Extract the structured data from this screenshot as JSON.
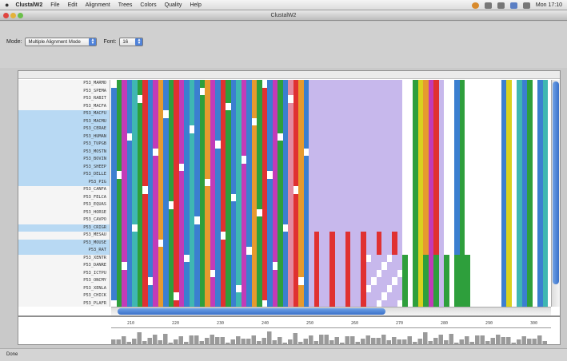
{
  "menubar": {
    "app_name": "ClustalW2",
    "menus": [
      "File",
      "Edit",
      "Alignment",
      "Trees",
      "Colors",
      "Quality",
      "Help"
    ],
    "status_text": "Mon 17:10"
  },
  "window": {
    "title": "ClustalW2"
  },
  "toolbar": {
    "mode_label": "Mode:",
    "mode_value": "Multiple Alignment Mode",
    "font_label": "Font:",
    "font_value": "16"
  },
  "alignment": {
    "sequences": [
      {
        "name": "P53_MARMO",
        "selected": false
      },
      {
        "name": "P53_SPEMA",
        "selected": false
      },
      {
        "name": "P53_RABIT",
        "selected": false
      },
      {
        "name": "P53_MACFA",
        "selected": false
      },
      {
        "name": "P53_MACFU",
        "selected": true
      },
      {
        "name": "P53_MACMU",
        "selected": true
      },
      {
        "name": "P53_CERAE",
        "selected": true
      },
      {
        "name": "P53_HUMAN",
        "selected": true
      },
      {
        "name": "P53_TUPGB",
        "selected": true
      },
      {
        "name": "P53_MOSTN",
        "selected": true
      },
      {
        "name": "P53_BOVIN",
        "selected": true
      },
      {
        "name": "P53_SHEEP",
        "selected": true
      },
      {
        "name": "P53_DELLE",
        "selected": true
      },
      {
        "name": "P53_PIG",
        "selected": true
      },
      {
        "name": "P53_CANFA",
        "selected": false
      },
      {
        "name": "P53_FELCA",
        "selected": false
      },
      {
        "name": "P53_EQUAS",
        "selected": false
      },
      {
        "name": "P53_HORSE",
        "selected": false
      },
      {
        "name": "P53_CAVPO",
        "selected": false
      },
      {
        "name": "P53_CRIGR",
        "selected": true
      },
      {
        "name": "P53_MESAU",
        "selected": false
      },
      {
        "name": "P53_MOUSE",
        "selected": true
      },
      {
        "name": "P53_RAT",
        "selected": true
      },
      {
        "name": "P53_XENTR",
        "selected": false
      },
      {
        "name": "P53_DANRE",
        "selected": false
      },
      {
        "name": "P53_ICTPU",
        "selected": false
      },
      {
        "name": "P53_ONCMY",
        "selected": false
      },
      {
        "name": "P53_XENLA",
        "selected": false
      },
      {
        "name": "P53_CHICK",
        "selected": false
      },
      {
        "name": "P53_PLAFR",
        "selected": false
      }
    ],
    "conservation_marks": ":  * .*  *: :*    .  :      : **  . .                                                    : *",
    "palette": {
      "hydrophobic": "#3b7fd0",
      "positive": "#e03131",
      "negative": "#c23bb8",
      "polar": "#2e9f3c",
      "glycine": "#e69a2e",
      "proline": "#d8d11f",
      "aromatic": "#3fb7b2",
      "cysteine": "#e48aa0",
      "gap": "#ffffff",
      "lowquality": "#c7b8ec"
    }
  },
  "quality": {
    "ruler_ticks": [
      "210",
      "220",
      "230",
      "240",
      "250",
      "260",
      "270",
      "280",
      "290",
      "300"
    ]
  },
  "statusbar": {
    "text": "Done"
  }
}
